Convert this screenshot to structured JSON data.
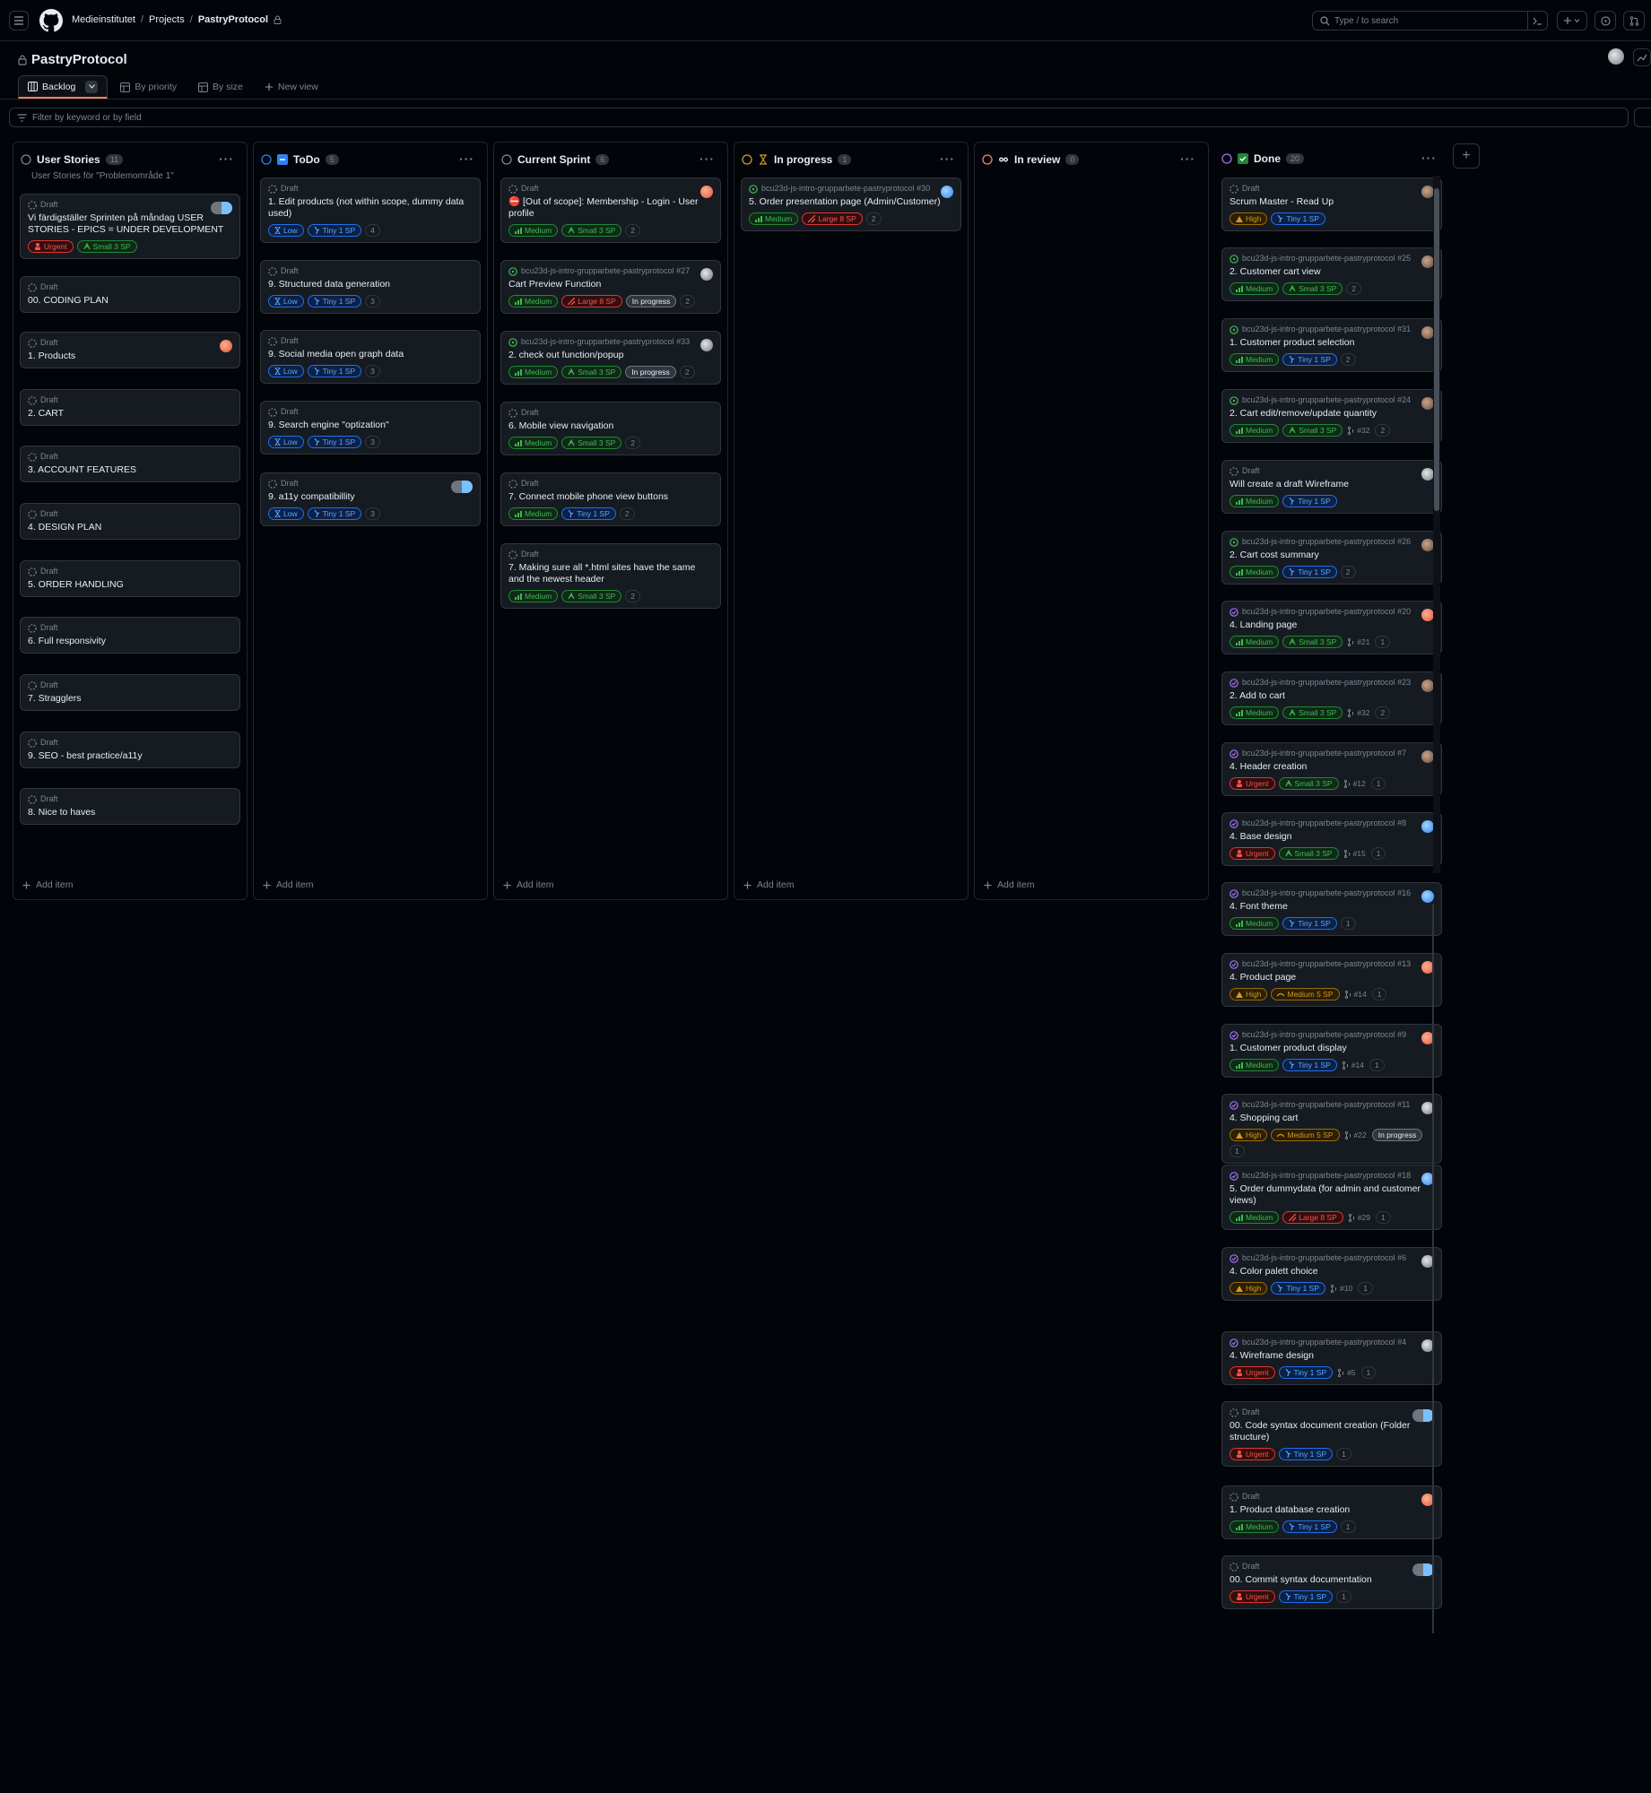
{
  "nav": {
    "org": "Medieinstitutet",
    "projects": "Projects",
    "project": "PastryProtocol",
    "search_placeholder": "Type / to search"
  },
  "project": {
    "title": "PastryProtocol",
    "views": [
      {
        "label": "Backlog",
        "active": true
      },
      {
        "label": "By priority"
      },
      {
        "label": "By size"
      },
      {
        "label": "New view"
      }
    ],
    "filter_placeholder": "Filter by keyword or by field"
  },
  "columns": [
    {
      "name": "User Stories",
      "count": "11",
      "description": "User Stories för \"Problemområde 1\"",
      "add_item": "Add item",
      "cards": [
        {
          "meta": "Draft",
          "title": "Vi färdigställer Sprinten på måndag USER STORIES - EPICS = UNDER DEVELOPMENT",
          "tags": [
            {
              "t": "Urgent",
              "k": "urgent"
            },
            {
              "t": "Small 3 SP",
              "k": "small"
            }
          ],
          "avatar": "double"
        },
        {
          "meta": "Draft",
          "title": "00. CODING PLAN",
          "tags": []
        },
        {
          "meta": "Draft",
          "title": "1. Products",
          "tags": [],
          "avatar": "orange"
        },
        {
          "meta": "Draft",
          "title": "2. CART",
          "tags": []
        },
        {
          "meta": "Draft",
          "title": "3. ACCOUNT FEATURES",
          "tags": []
        },
        {
          "meta": "Draft",
          "title": "4. DESIGN PLAN",
          "tags": []
        },
        {
          "meta": "Draft",
          "title": "5. ORDER HANDLING",
          "tags": []
        },
        {
          "meta": "Draft",
          "title": "6. Full responsivity",
          "tags": []
        },
        {
          "meta": "Draft",
          "title": "7. Stragglers",
          "tags": []
        },
        {
          "meta": "Draft",
          "title": "9. SEO - best practice/a11y",
          "tags": []
        },
        {
          "meta": "Draft",
          "title": "8. Nice to haves",
          "tags": []
        }
      ]
    },
    {
      "name": "ToDo",
      "count": "5",
      "description": "",
      "add_item": "Add item",
      "cards": [
        {
          "meta": "Draft",
          "title": "1. Edit products (not within scope, dummy data used)",
          "tags": [
            {
              "t": "Low",
              "k": "low"
            },
            {
              "t": "Tiny 1 SP",
              "k": "tiny"
            },
            {
              "t": "4",
              "k": "num"
            }
          ]
        },
        {
          "meta": "Draft",
          "title": "9. Structured data generation",
          "tags": [
            {
              "t": "Low",
              "k": "low"
            },
            {
              "t": "Tiny 1 SP",
              "k": "tiny"
            },
            {
              "t": "3",
              "k": "num"
            }
          ]
        },
        {
          "meta": "Draft",
          "title": "9. Social media open graph data",
          "tags": [
            {
              "t": "Low",
              "k": "low"
            },
            {
              "t": "Tiny 1 SP",
              "k": "tiny"
            },
            {
              "t": "3",
              "k": "num"
            }
          ]
        },
        {
          "meta": "Draft",
          "title": "9. Search engine \"optization\"",
          "tags": [
            {
              "t": "Low",
              "k": "low"
            },
            {
              "t": "Tiny 1 SP",
              "k": "tiny"
            },
            {
              "t": "3",
              "k": "num"
            }
          ]
        },
        {
          "meta": "Draft",
          "title": "9. a11y compatibillity",
          "tags": [
            {
              "t": "Low",
              "k": "low"
            },
            {
              "t": "Tiny 1 SP",
              "k": "tiny"
            },
            {
              "t": "3",
              "k": "num"
            }
          ],
          "avatar": "double"
        }
      ]
    },
    {
      "name": "Current Sprint",
      "count": "6",
      "description": "",
      "add_item": "Add item",
      "cards": [
        {
          "meta": "Draft",
          "title": "⛔ [Out of scope]: Membership - Login - User profile",
          "tags": [
            {
              "t": "Medium",
              "k": "medium"
            },
            {
              "t": "Small 3 SP",
              "k": "small"
            },
            {
              "t": "2",
              "k": "num"
            }
          ],
          "avatar": "orange"
        },
        {
          "meta": "bcu23d-js-intro-grupparbete-pastryprotocol #27",
          "title": "Cart Preview Function",
          "tags": [
            {
              "t": "Medium",
              "k": "medium"
            },
            {
              "t": "Large 8 SP",
              "k": "large"
            },
            {
              "t": "In progress",
              "k": "status"
            },
            {
              "t": "2",
              "k": "num"
            }
          ],
          "avatar": "gray",
          "issue": true
        },
        {
          "meta": "bcu23d-js-intro-grupparbete-pastryprotocol #33",
          "title": "2. check out function/popup",
          "tags": [
            {
              "t": "Medium",
              "k": "medium"
            },
            {
              "t": "Small 3 SP",
              "k": "small"
            },
            {
              "t": "In progress",
              "k": "status"
            },
            {
              "t": "2",
              "k": "num"
            }
          ],
          "avatar": "gray",
          "issue": true
        },
        {
          "meta": "Draft",
          "title": "6. Mobile view navigation",
          "tags": [
            {
              "t": "Medium",
              "k": "medium"
            },
            {
              "t": "Small 3 SP",
              "k": "small"
            },
            {
              "t": "2",
              "k": "num"
            }
          ]
        },
        {
          "meta": "Draft",
          "title": "7. Connect mobile phone view buttons",
          "tags": [
            {
              "t": "Medium",
              "k": "medium"
            },
            {
              "t": "Tiny 1 SP",
              "k": "tiny"
            },
            {
              "t": "2",
              "k": "num"
            }
          ]
        },
        {
          "meta": "Draft",
          "title": "7. Making sure all *.html sites have the same and the newest header",
          "tags": [
            {
              "t": "Medium",
              "k": "medium"
            },
            {
              "t": "Small 3 SP",
              "k": "small"
            },
            {
              "t": "2",
              "k": "num"
            }
          ]
        }
      ]
    },
    {
      "name": "In progress",
      "count": "1",
      "description": "",
      "add_item": "Add item",
      "cards": [
        {
          "meta": "bcu23d-js-intro-grupparbete-pastryprotocol #30",
          "title": "5. Order presentation page (Admin/Customer)",
          "tags": [
            {
              "t": "Medium",
              "k": "medium"
            },
            {
              "t": "Large 8 SP",
              "k": "large"
            },
            {
              "t": "2",
              "k": "num"
            }
          ],
          "avatar": "blue",
          "issue": true
        }
      ]
    },
    {
      "name": "In review",
      "count": "0",
      "description": "",
      "add_item": "Add item",
      "cards": []
    },
    {
      "name": "Done",
      "count": "20",
      "description": "",
      "add_item": "",
      "cards": [
        {
          "meta": "Draft",
          "title": "Scrum Master - Read Up",
          "tags": [
            {
              "t": "High",
              "k": "high"
            },
            {
              "t": "Tiny 1 SP",
              "k": "tiny"
            }
          ],
          "avatar": "photo"
        },
        {
          "meta": "bcu23d-js-intro-grupparbete-pastryprotocol #25",
          "title": "2. Customer cart view",
          "tags": [
            {
              "t": "Medium",
              "k": "medium"
            },
            {
              "t": "Small 3 SP",
              "k": "small"
            },
            {
              "t": "2",
              "k": "num"
            }
          ],
          "avatar": "photo",
          "issue": true
        },
        {
          "meta": "bcu23d-js-intro-grupparbete-pastryprotocol #31",
          "title": "1. Customer product selection",
          "tags": [
            {
              "t": "Medium",
              "k": "medium"
            },
            {
              "t": "Tiny 1 SP",
              "k": "tiny"
            },
            {
              "t": "2",
              "k": "num"
            }
          ],
          "avatar": "photo",
          "issue": true
        },
        {
          "meta": "bcu23d-js-intro-grupparbete-pastryprotocol #24",
          "title": "2. Cart edit/remove/update quantity",
          "tags": [
            {
              "t": "Medium",
              "k": "medium"
            },
            {
              "t": "Small 3 SP",
              "k": "small"
            },
            {
              "t": "#32",
              "k": "pr"
            },
            {
              "t": "2",
              "k": "num"
            }
          ],
          "avatar": "photo",
          "issue": true
        },
        {
          "meta": "Draft",
          "title": "Will create a draft Wireframe",
          "tags": [
            {
              "t": "Medium",
              "k": "medium"
            },
            {
              "t": "Tiny 1 SP",
              "k": "tiny"
            }
          ],
          "avatar": "gray"
        },
        {
          "meta": "bcu23d-js-intro-grupparbete-pastryprotocol #26",
          "title": "2. Cart cost summary",
          "tags": [
            {
              "t": "Medium",
              "k": "medium"
            },
            {
              "t": "Tiny 1 SP",
              "k": "tiny"
            },
            {
              "t": "2",
              "k": "num"
            }
          ],
          "avatar": "photo",
          "issue": true
        },
        {
          "meta": "bcu23d-js-intro-grupparbete-pastryprotocol #20",
          "title": "4. Landing page",
          "tags": [
            {
              "t": "Medium",
              "k": "medium"
            },
            {
              "t": "Small 3 SP",
              "k": "small"
            },
            {
              "t": "#21",
              "k": "pr"
            },
            {
              "t": "1",
              "k": "num"
            }
          ],
          "avatar": "orange",
          "closed": true
        },
        {
          "meta": "bcu23d-js-intro-grupparbete-pastryprotocol #23",
          "title": "2. Add to cart",
          "tags": [
            {
              "t": "Medium",
              "k": "medium"
            },
            {
              "t": "Small 3 SP",
              "k": "small"
            },
            {
              "t": "#32",
              "k": "pr"
            },
            {
              "t": "2",
              "k": "num"
            }
          ],
          "avatar": "photo",
          "closed": true
        },
        {
          "meta": "bcu23d-js-intro-grupparbete-pastryprotocol #7",
          "title": "4. Header creation",
          "tags": [
            {
              "t": "Urgent",
              "k": "urgent"
            },
            {
              "t": "Small 3 SP",
              "k": "small"
            },
            {
              "t": "#12",
              "k": "pr"
            },
            {
              "t": "1",
              "k": "num"
            }
          ],
          "avatar": "photo",
          "closed": true
        },
        {
          "meta": "bcu23d-js-intro-grupparbete-pastryprotocol #8",
          "title": "4. Base design",
          "tags": [
            {
              "t": "Urgent",
              "k": "urgent"
            },
            {
              "t": "Small 3 SP",
              "k": "small"
            },
            {
              "t": "#15",
              "k": "pr"
            },
            {
              "t": "1",
              "k": "num"
            }
          ],
          "avatar": "blue",
          "closed": true
        },
        {
          "meta": "bcu23d-js-intro-grupparbete-pastryprotocol #16",
          "title": "4. Font theme",
          "tags": [
            {
              "t": "Medium",
              "k": "medium"
            },
            {
              "t": "Tiny 1 SP",
              "k": "tiny"
            },
            {
              "t": "1",
              "k": "num"
            }
          ],
          "avatar": "blue",
          "closed": true
        },
        {
          "meta": "bcu23d-js-intro-grupparbete-pastryprotocol #13",
          "title": "4. Product page",
          "tags": [
            {
              "t": "High",
              "k": "high"
            },
            {
              "t": "Medium 5 SP",
              "k": "mediumsp"
            },
            {
              "t": "#14",
              "k": "pr"
            },
            {
              "t": "1",
              "k": "num"
            }
          ],
          "avatar": "orange",
          "closed": true
        },
        {
          "meta": "bcu23d-js-intro-grupparbete-pastryprotocol #9",
          "title": "1. Customer product display",
          "tags": [
            {
              "t": "Medium",
              "k": "medium"
            },
            {
              "t": "Tiny 1 SP",
              "k": "tiny"
            },
            {
              "t": "#14",
              "k": "pr"
            },
            {
              "t": "1",
              "k": "num"
            }
          ],
          "avatar": "orange",
          "closed": true
        },
        {
          "meta": "bcu23d-js-intro-grupparbete-pastryprotocol #11",
          "title": "4. Shopping cart",
          "tags": [
            {
              "t": "High",
              "k": "high"
            },
            {
              "t": "Medium 5 SP",
              "k": "mediumsp"
            },
            {
              "t": "#22",
              "k": "pr"
            },
            {
              "t": "In progress",
              "k": "status"
            },
            {
              "t": "1",
              "k": "num"
            }
          ],
          "avatar": "gray",
          "closed": true
        },
        {
          "meta": "bcu23d-js-intro-grupparbete-pastryprotocol #18",
          "title": "5. Order dummydata (for admin and customer views)",
          "tags": [
            {
              "t": "Medium",
              "k": "medium"
            },
            {
              "t": "Large 8 SP",
              "k": "large"
            },
            {
              "t": "#29",
              "k": "pr"
            },
            {
              "t": "1",
              "k": "num"
            }
          ],
          "avatar": "blue",
          "closed": true
        },
        {
          "meta": "bcu23d-js-intro-grupparbete-pastryprotocol #6",
          "title": "4. Color palett choice",
          "tags": [
            {
              "t": "High",
              "k": "high"
            },
            {
              "t": "Tiny 1 SP",
              "k": "tiny"
            },
            {
              "t": "#10",
              "k": "pr"
            },
            {
              "t": "1",
              "k": "num"
            }
          ],
          "avatar": "gray",
          "closed": true
        },
        {
          "meta": "bcu23d-js-intro-grupparbete-pastryprotocol #4",
          "title": "4. Wireframe design",
          "tags": [
            {
              "t": "Urgent",
              "k": "urgent"
            },
            {
              "t": "Tiny 1 SP",
              "k": "tiny"
            },
            {
              "t": "#5",
              "k": "pr"
            },
            {
              "t": "1",
              "k": "num"
            }
          ],
          "avatar": "gray",
          "closed": true
        },
        {
          "meta": "Draft",
          "title": "00. Code syntax document creation (Folder structure)",
          "tags": [
            {
              "t": "Urgent",
              "k": "urgent"
            },
            {
              "t": "Tiny 1 SP",
              "k": "tiny"
            },
            {
              "t": "1",
              "k": "num"
            }
          ],
          "avatar": "double"
        },
        {
          "meta": "Draft",
          "title": "1. Product database creation",
          "tags": [
            {
              "t": "Medium",
              "k": "medium"
            },
            {
              "t": "Tiny 1 SP",
              "k": "tiny"
            },
            {
              "t": "1",
              "k": "num"
            }
          ],
          "avatar": "orange"
        },
        {
          "meta": "Draft",
          "title": "00. Commit syntax documentation",
          "tags": [
            {
              "t": "Urgent",
              "k": "urgent"
            },
            {
              "t": "Tiny 1 SP",
              "k": "tiny"
            },
            {
              "t": "1",
              "k": "num"
            }
          ],
          "avatar": "double"
        }
      ]
    }
  ]
}
